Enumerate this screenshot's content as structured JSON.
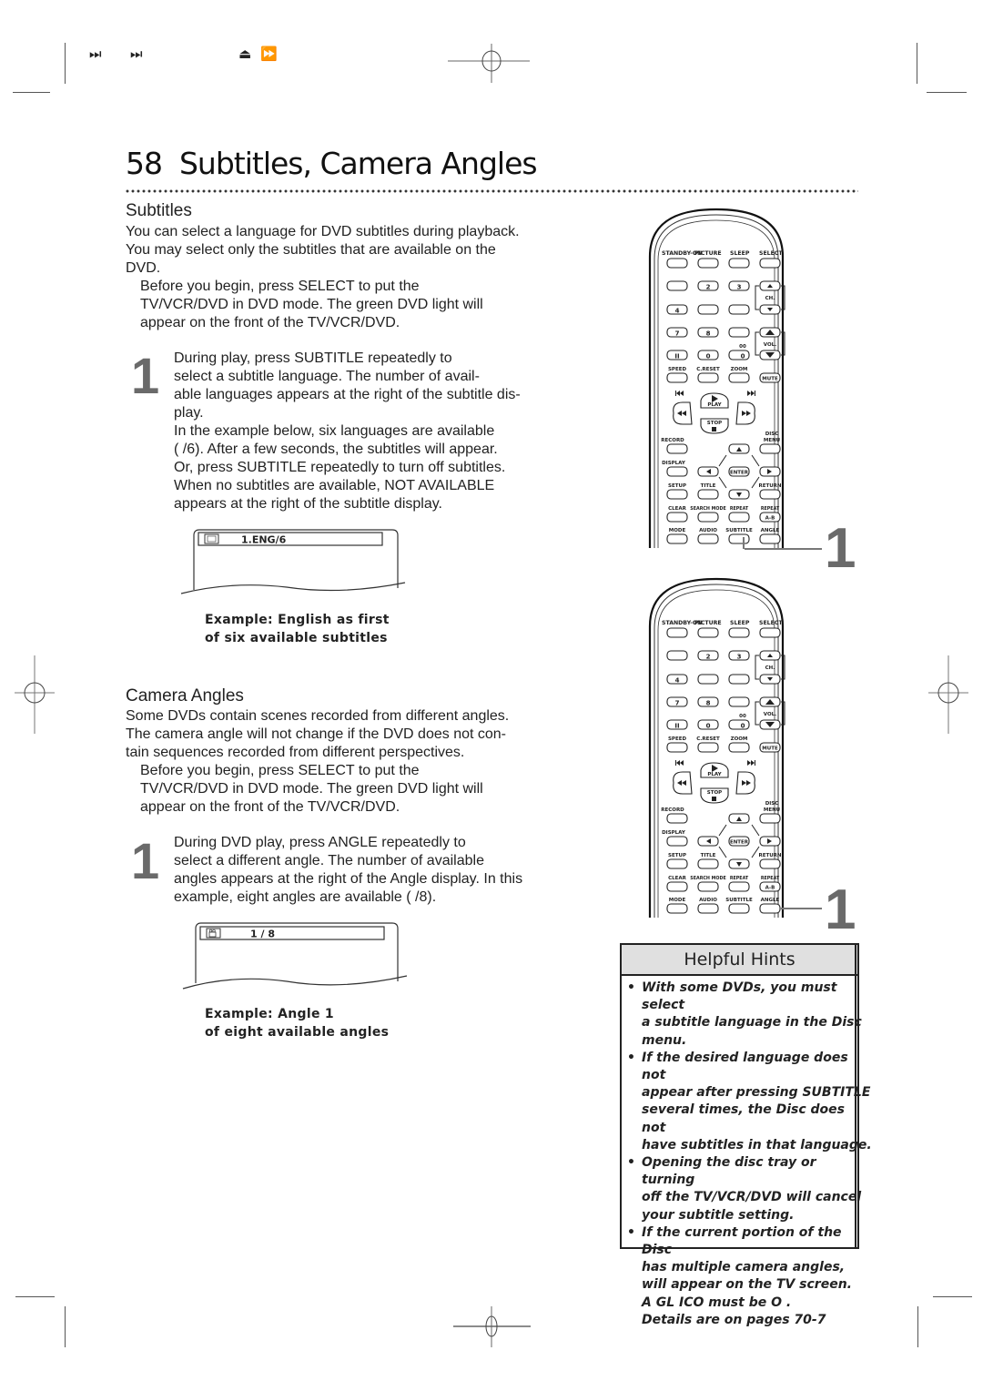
{
  "header": {
    "nav_icons": [
      {
        "name": "skip-next-icon",
        "glyph": "⏭"
      },
      {
        "name": "skip-next-icon",
        "glyph": "⏭"
      },
      {
        "name": "eject-icon",
        "glyph": "⏏"
      },
      {
        "name": "fast-forward-icon",
        "glyph": "⏩"
      }
    ]
  },
  "page": {
    "number": "58",
    "title": "Subtitles, Camera Angles"
  },
  "subtitles": {
    "heading": "Subtitles",
    "intro": [
      "You can select a language for DVD subtitles during playback.",
      "You may select only the subtitles that are available on the",
      "DVD."
    ],
    "before": [
      "Before you begin, press SELECT   to put the",
      "TV/VCR/DVD in DVD mode. The green DVD light will",
      "appear on the front of the TV/VCR/DVD."
    ],
    "step_number": "1",
    "step_lines": [
      "During play, press SUBTITLE repeatedly to",
      "select a subtitle language.   The number of avail-",
      "able languages appears at the right of the subtitle dis-",
      "play.",
      "In the example below, six languages are available",
      "(  /6). After a few seconds, the subtitles will appear.",
      "Or, press SUBTITLE repeatedly to turn off subtitles.",
      "When no subtitles are available, NOT AVAILABLE",
      "appears at the right of the subtitle display."
    ],
    "osd_text": "1.ENG/6",
    "osd_icon": "subtitle-icon",
    "caption": [
      "Example: English as first",
      "of six available subtitles"
    ]
  },
  "camera_angles": {
    "heading": "Camera Angles",
    "intro": [
      "Some DVDs contain scenes recorded from different angles.",
      "The camera angle will not change if the DVD does not con-",
      "tain sequences recorded from different perspectives."
    ],
    "before": [
      "Before you begin, press SELECT   to put the",
      "TV/VCR/DVD in DVD mode. The green DVD light will",
      "appear on the front of the TV/VCR/DVD."
    ],
    "step_number": "1",
    "step_lines": [
      "During DVD play, press ANGLE repeatedly to",
      "select a different angle.  The number of available",
      "angles appears at the right of the Angle display. In this",
      "example, eight angles are available (  /8)."
    ],
    "osd_text": "1 / 8",
    "osd_icon": "camera-angle-icon",
    "caption": [
      "Example: Angle 1",
      "of eight available angles"
    ]
  },
  "remote": {
    "labels": {
      "standby": "STANDBY-ON",
      "picture": "PICTURE",
      "sleep": "SLEEP",
      "select": "SELECT",
      "n2": "2",
      "n3": "3",
      "n4": "4",
      "n7": "7",
      "n8": "8",
      "pause": "II",
      "n0": "0",
      "zero_b": "0",
      "dbl0": "00",
      "ch": "CH.",
      "vol": "VOL.",
      "speed": "SPEED",
      "creset": "C.RESET",
      "zoom": "ZOOM",
      "mute": "MUTE",
      "play": "PLAY",
      "stop": "STOP",
      "record": "RECORD",
      "disc": "DISC",
      "menu": "MENU",
      "display": "DISPLAY",
      "enter": "ENTER",
      "setup": "SETUP",
      "title": "TITLE",
      "return": "RETURN",
      "clear": "CLEAR",
      "searchmode": "SEARCH MODE",
      "repeat": "REPEAT",
      "repeat2": "REPEAT",
      "ab": "A-B",
      "mode": "MODE",
      "audio": "AUDIO",
      "subtitle": "SUBTITLE",
      "angle": "ANGLE"
    },
    "callouts": [
      {
        "step": "1",
        "button": "SUBTITLE"
      },
      {
        "step": "1",
        "button": "ANGLE"
      }
    ]
  },
  "hints": {
    "title": "Helpful Hints",
    "items": [
      "With some DVDs, you must select a subtitle language in the Disc menu.",
      "If the desired language does not appear after pressing SUBTITLE several times, the Disc does not have subtitles in that language.",
      "Opening the disc tray or turning off the TV/VCR/DVD will cancel your subtitle setting.",
      "If the current portion of the Disc has multiple camera angles, will appear on the TV screen. A GL ICO must be O . Details are on pages 70-7"
    ],
    "item_lines": [
      [
        "With some DVDs, you must select",
        "a subtitle language in the Disc",
        "menu."
      ],
      [
        "If the desired language does not",
        "appear after pressing SUBTITLE",
        "several times, the Disc does not",
        "have subtitles in that language."
      ],
      [
        "Opening the disc tray or turning",
        "off the TV/VCR/DVD will cancel",
        "your subtitle setting."
      ],
      [
        "If the current portion of the Disc",
        "has multiple camera angles,",
        "will appear on the TV screen.",
        "A  GL  ICO   must be O  .",
        "Details are on pages 70-7"
      ]
    ]
  }
}
